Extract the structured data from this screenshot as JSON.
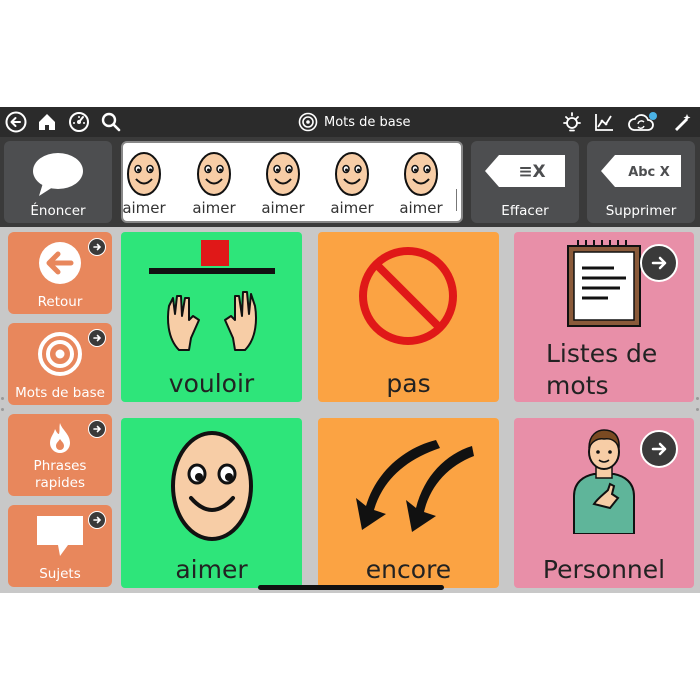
{
  "topbar": {
    "title": "Mots de base",
    "left_icons": [
      "back-circle-icon",
      "home-icon",
      "speed-gauge-icon",
      "search-icon"
    ],
    "right_icons": [
      "brightness-icon",
      "analytics-chart-icon",
      "cloud-sync-icon",
      "edit-wand-icon"
    ]
  },
  "actionbar": {
    "speak_label": "Énoncer",
    "clear_label": "Effacer",
    "clear_icon_text": "≡X",
    "delete_label": "Supprimer",
    "delete_icon_text": "Abc X",
    "message": [
      "aimer",
      "aimer",
      "aimer",
      "aimer",
      "aimer"
    ]
  },
  "nav": [
    {
      "label": "Retour",
      "icon": "back-arrow-icon"
    },
    {
      "label": "Mots de base",
      "icon": "target-icon"
    },
    {
      "label": "Phrases rapides",
      "icon": "flame-icon"
    },
    {
      "label": "Sujets",
      "icon": "speech-bubble-icon"
    }
  ],
  "grid": [
    {
      "word": "vouloir",
      "color": "#2ee57a",
      "icon": "want-hands-icon"
    },
    {
      "word": "pas",
      "color": "#fba343",
      "icon": "no-sign-icon"
    },
    {
      "word_line1": "Listes de",
      "word_line2": "mots",
      "color": "#e88fa8",
      "icon": "notepad-list-icon"
    },
    {
      "word": "aimer",
      "color": "#2ee57a",
      "icon": "smiling-face-icon"
    },
    {
      "word": "encore",
      "color": "#fba343",
      "icon": "again-arrows-icon"
    },
    {
      "word": "Personnel",
      "color": "#e88fa8",
      "icon": "person-pointing-icon"
    }
  ],
  "colors": {
    "verb_green": "#2ee57a",
    "orange": "#fba343",
    "pink": "#e88fa8",
    "nav_orange": "#e8875c",
    "dark_button": "#4d4e50"
  }
}
